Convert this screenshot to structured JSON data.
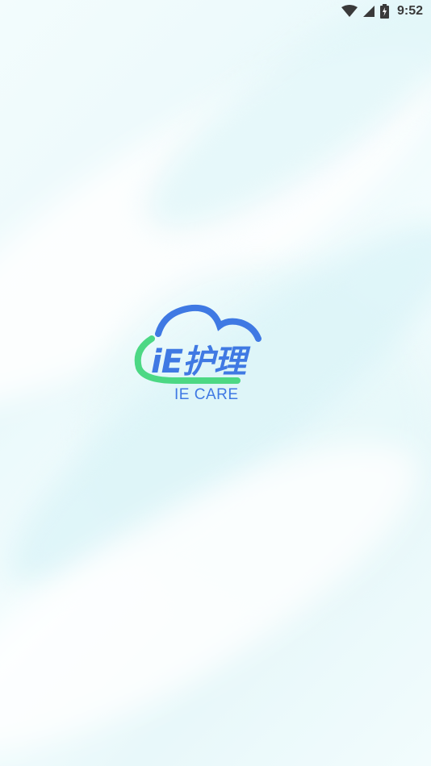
{
  "status_bar": {
    "time": "9:52",
    "icons": [
      "wifi-icon",
      "cellular-signal-icon",
      "battery-charging-icon"
    ]
  },
  "splash": {
    "logo_title": "iE护理",
    "logo_subtitle": "IE CARE"
  },
  "colors": {
    "brand_blue": "#3f79e3",
    "brand_green": "#4cd884",
    "background": "#eefbfd"
  }
}
